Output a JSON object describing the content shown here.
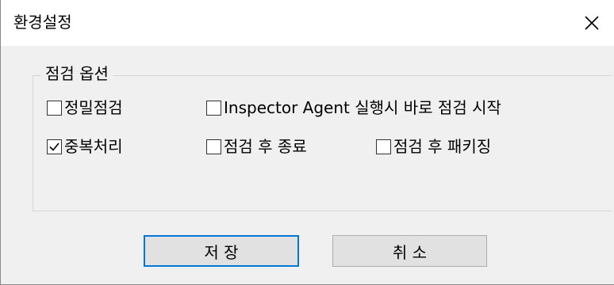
{
  "window": {
    "title": "환경설정",
    "close_glyph": "✕"
  },
  "options_group": {
    "legend": "점검 옵션",
    "items": [
      {
        "label": "정밀점검",
        "checked": false
      },
      {
        "label": "Inspector Agent 실행시 바로 점검 시작",
        "checked": false
      },
      {
        "label": "중복처리",
        "checked": true
      },
      {
        "label": "점검 후 종료",
        "checked": false
      },
      {
        "label": "점검 후 패키징",
        "checked": false
      }
    ]
  },
  "buttons": {
    "save_label": "저 장",
    "cancel_label": "취 소"
  },
  "colors": {
    "focus_border": "#0078d7",
    "button_face": "#e1e1e1",
    "dialog_bg": "#f0f0f0"
  }
}
